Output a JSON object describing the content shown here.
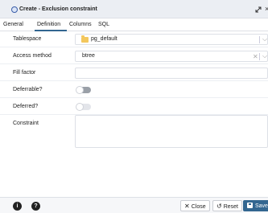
{
  "dialog": {
    "title": "Create - Exclusion constraint"
  },
  "tabs": [
    {
      "label": "General",
      "active": false
    },
    {
      "label": "Definition",
      "active": true
    },
    {
      "label": "Columns",
      "active": false
    },
    {
      "label": "SQL",
      "active": false
    }
  ],
  "form": {
    "tablespace": {
      "label": "Tablespace",
      "value": "pg_default"
    },
    "access_method": {
      "label": "Access method",
      "value": "btree"
    },
    "fill_factor": {
      "label": "Fill factor",
      "value": ""
    },
    "deferrable": {
      "label": "Deferrable?",
      "value": false
    },
    "deferred": {
      "label": "Deferred?",
      "value": false
    },
    "constraint": {
      "label": "Constraint",
      "value": ""
    }
  },
  "footer": {
    "info_label": "i",
    "help_label": "?",
    "close_label": "Close",
    "reset_label": "Reset",
    "save_label": "Save"
  },
  "colors": {
    "accent": "#326690",
    "folder": "#f3c75d"
  }
}
